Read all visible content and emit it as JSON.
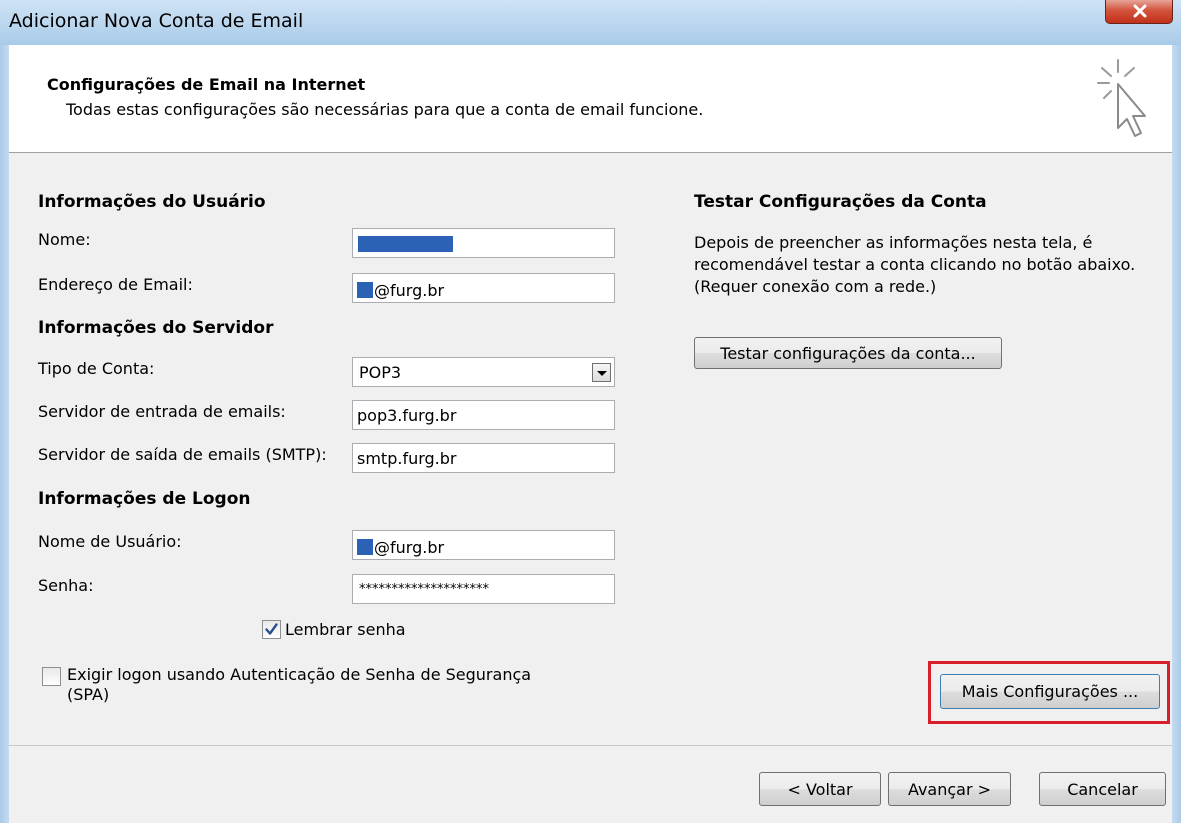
{
  "window": {
    "title": "Adicionar Nova Conta de Email"
  },
  "header": {
    "title": "Configurações de Email na Internet",
    "subtitle": "Todas estas configurações são necessárias para que a conta de email funcione."
  },
  "user_info": {
    "heading": "Informações do Usuário",
    "name_label": "Nome:",
    "name_value": "",
    "email_label": "Endereço de Email:",
    "email_value": "@furg.br"
  },
  "server_info": {
    "heading": "Informações do Servidor",
    "account_type_label": "Tipo de Conta:",
    "account_type_value": "POP3",
    "incoming_label": "Servidor de entrada de emails:",
    "incoming_value": "pop3.furg.br",
    "outgoing_label": "Servidor de saída de emails (SMTP):",
    "outgoing_value": "smtp.furg.br"
  },
  "logon_info": {
    "heading": "Informações de Logon",
    "username_label": "Nome de Usuário:",
    "username_value": "@furg.br",
    "password_label": "Senha:",
    "password_value": "********************",
    "remember_label": "Lembrar senha",
    "remember_checked": true,
    "spa_label_line1": "Exigir logon usando Autenticação de Senha de Segurança",
    "spa_label_line2": "(SPA)",
    "spa_checked": false
  },
  "test_section": {
    "heading": "Testar Configurações da Conta",
    "desc_line1": "Depois de preencher as informações nesta tela, é",
    "desc_line2": "recomendável testar a conta clicando no botão abaixo.",
    "desc_line3": "(Requer conexão com a rede.)",
    "test_button": "Testar configurações da conta..."
  },
  "more_settings_button": "Mais Configurações ...",
  "nav": {
    "back": "< Voltar",
    "next": "Avançar >",
    "cancel": "Cancelar"
  },
  "colors": {
    "highlight": "#d61f2b",
    "redaction": "#2b62b5",
    "title_bar": "#bcd7ef"
  }
}
